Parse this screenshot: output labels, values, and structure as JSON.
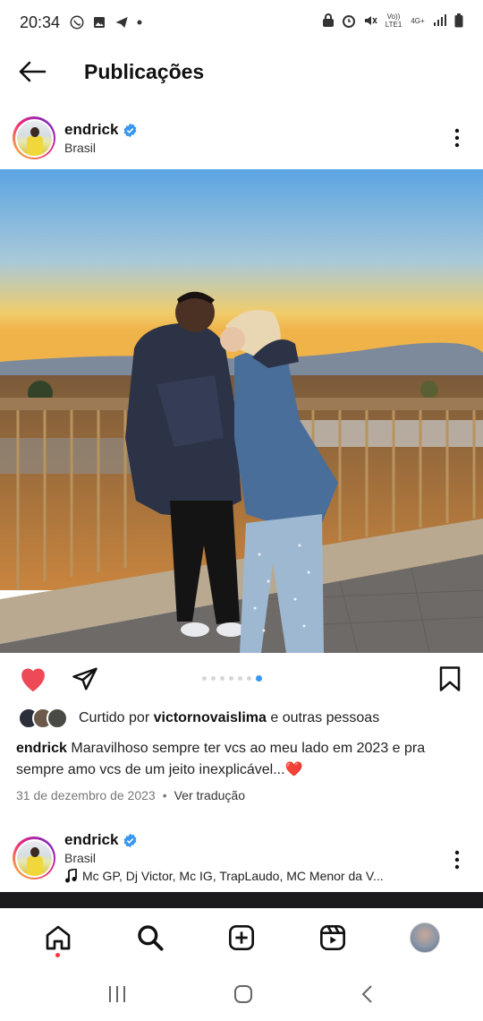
{
  "status_bar": {
    "time": "20:34",
    "network_top": "Vo)) LTE1",
    "network_gen": "4G+"
  },
  "header": {
    "title": "Publicações"
  },
  "post": {
    "username": "endrick",
    "location": "Brasil",
    "carousel": {
      "total": 7,
      "active_index": 6
    },
    "likes_prefix": "Curtido por",
    "likes_user": "victornovaislima",
    "likes_suffix": "e outras pessoas",
    "caption_user": "endrick",
    "caption_text": "Maravilhoso sempre ter vcs ao meu lado em 2023 e pra sempre amo vcs de um jeito inexplicável...❤️",
    "date": "31 de dezembro de 2023",
    "date_separator": "•",
    "translate": "Ver tradução"
  },
  "next_post": {
    "username": "endrick",
    "location": "Brasil",
    "music": "Mc GP, Dj Victor, Mc IG, TrapLaudo, MC Menor da V..."
  },
  "bottom_nav": [
    "home-icon",
    "search-icon",
    "create-icon",
    "reels-icon",
    "profile"
  ],
  "colors": {
    "like": "#ed4956",
    "verified": "#3897f0",
    "active_dot": "#3897f0"
  }
}
